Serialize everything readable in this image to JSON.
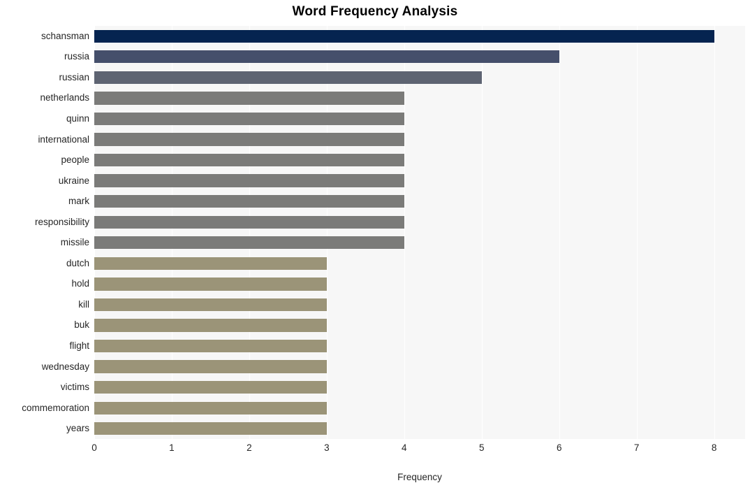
{
  "chart_data": {
    "type": "bar",
    "orientation": "horizontal",
    "title": "Word Frequency Analysis",
    "xlabel": "Frequency",
    "ylabel": "",
    "xlim": [
      0,
      8.4
    ],
    "ylim": [
      0,
      20
    ],
    "grid": true,
    "grid_axis": "x",
    "legend": false,
    "categories": [
      "schansman",
      "russia",
      "russian",
      "netherlands",
      "quinn",
      "international",
      "people",
      "ukraine",
      "mark",
      "responsibility",
      "missile",
      "dutch",
      "hold",
      "kill",
      "buk",
      "flight",
      "wednesday",
      "victims",
      "commemoration",
      "years"
    ],
    "values": [
      8,
      6,
      5,
      4,
      4,
      4,
      4,
      4,
      4,
      4,
      4,
      3,
      3,
      3,
      3,
      3,
      3,
      3,
      3,
      3
    ],
    "bar_colors": [
      "#052450",
      "#454f6b",
      "#5e6472",
      "#7b7b79",
      "#7b7b79",
      "#7b7b79",
      "#7b7b79",
      "#7b7b79",
      "#7b7b79",
      "#7b7b79",
      "#7b7b79",
      "#9b9478",
      "#9b9478",
      "#9b9478",
      "#9b9478",
      "#9b9478",
      "#9b9478",
      "#9b9478",
      "#9b9478",
      "#9b9478"
    ],
    "x_ticks": [
      0,
      1,
      2,
      3,
      4,
      5,
      6,
      7,
      8
    ],
    "x_tick_labels": [
      "0",
      "1",
      "2",
      "3",
      "4",
      "5",
      "6",
      "7",
      "8"
    ],
    "plot_background": "#f7f7f7",
    "figure_background": "#ffffff",
    "gridline_color": "#ffffff",
    "tick_label_color": "#262626",
    "title_color": "#000000"
  }
}
